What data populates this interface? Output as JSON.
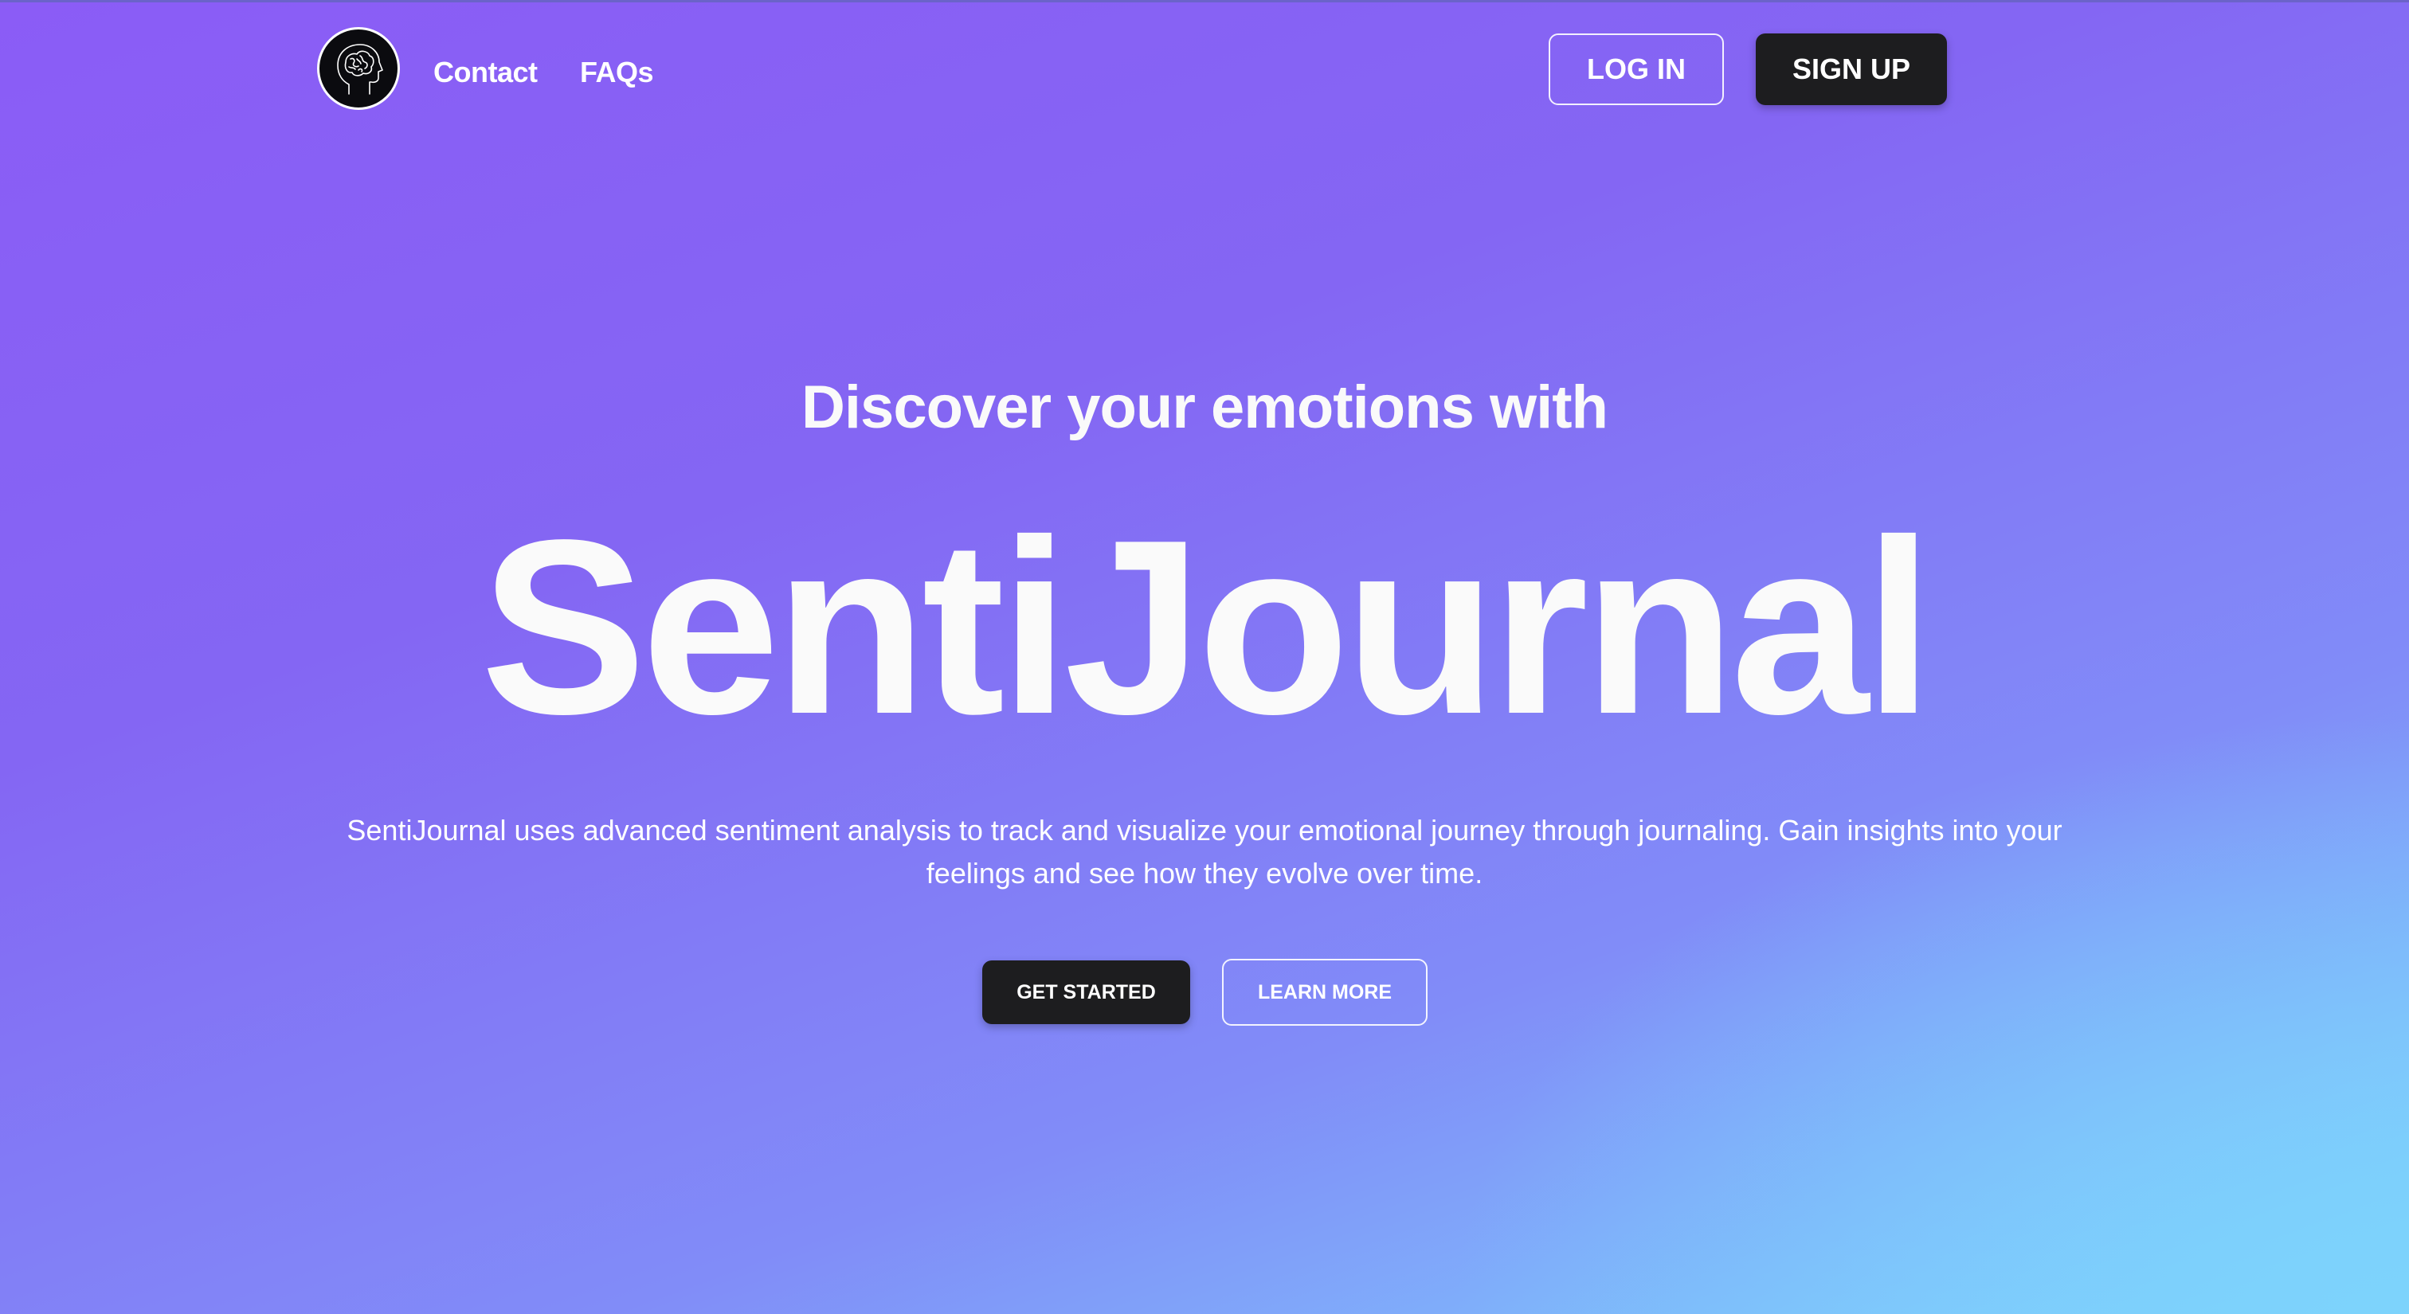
{
  "nav": {
    "logo_icon": "brain-head-icon",
    "links": [
      {
        "label": "Contact"
      },
      {
        "label": "FAQs"
      }
    ],
    "login_label": "LOG IN",
    "signup_label": "SIGN UP"
  },
  "hero": {
    "subtitle": "Discover your emotions with",
    "title": "SentiJournal",
    "description": "SentiJournal uses advanced sentiment analysis to track and visualize your emotional journey through journaling. Gain insights into your feelings and see how they evolve over time.",
    "primary_cta": "GET STARTED",
    "secondary_cta": "LEARN MORE"
  },
  "colors": {
    "gradient_start": "#8b5cf6",
    "gradient_end": "#7dd3fc",
    "button_dark": "#1d1d1f",
    "text_light": "#fafafa"
  }
}
